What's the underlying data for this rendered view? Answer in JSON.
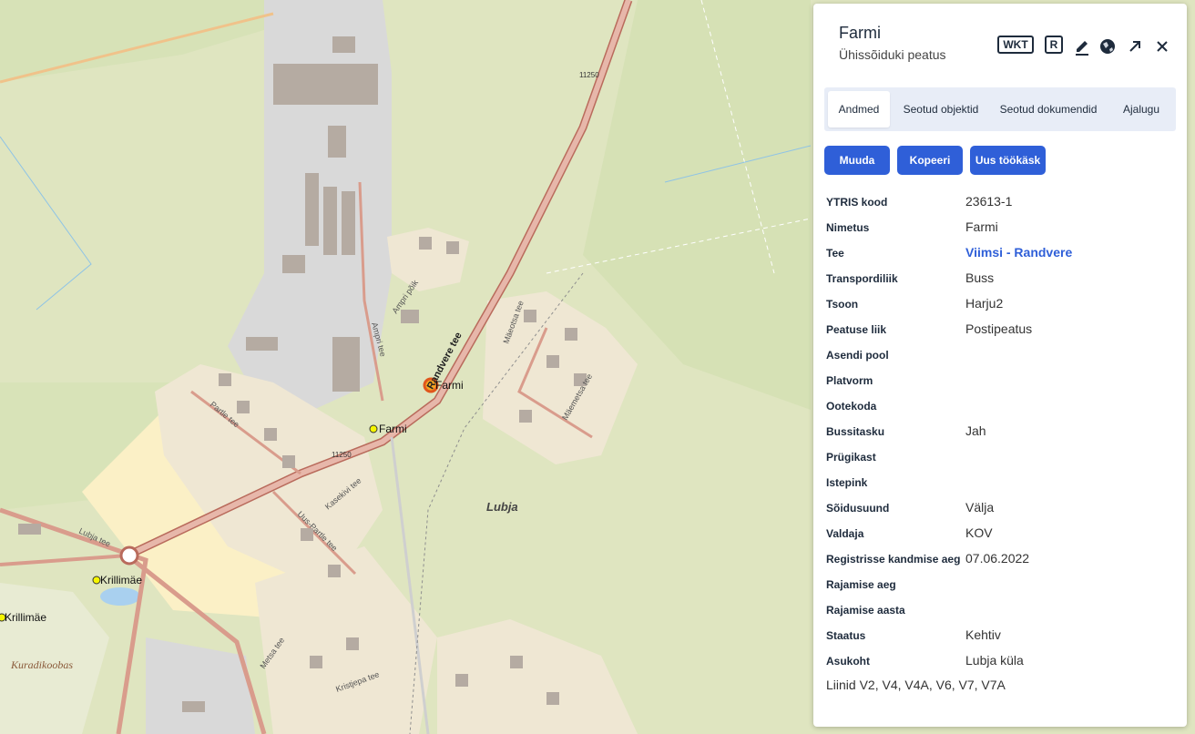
{
  "panel": {
    "title": "Farmi",
    "subtitle": "Ühissõiduki peatus",
    "toolbar": {
      "wkt_label": "WKT",
      "r_label": "R",
      "edit_icon": "pencil-icon",
      "globe_icon": "globe-icon",
      "open_icon": "arrow-up-right-icon",
      "close_icon": "close-icon"
    },
    "tabs": [
      {
        "label": "Andmed",
        "active": true
      },
      {
        "label": "Seotud objektid",
        "active": false
      },
      {
        "label": "Seotud dokumendid",
        "active": false
      },
      {
        "label": "Ajalugu",
        "active": false
      }
    ],
    "buttons": {
      "edit": "Muuda",
      "copy": "Kopeeri",
      "new_task": "Uus töökäsk"
    },
    "fields": [
      {
        "label": "YTRIS kood",
        "value": "23613-1"
      },
      {
        "label": "Nimetus",
        "value": "Farmi"
      },
      {
        "label": "Tee",
        "value": "Viimsi - Randvere",
        "link": true
      },
      {
        "label": "Transpordiliik",
        "value": "Buss"
      },
      {
        "label": "Tsoon",
        "value": "Harju2"
      },
      {
        "label": "Peatuse liik",
        "value": "Postipeatus"
      },
      {
        "label": "Asendi pool",
        "value": ""
      },
      {
        "label": "Platvorm",
        "value": ""
      },
      {
        "label": "Ootekoda",
        "value": ""
      },
      {
        "label": "Bussitasku",
        "value": "Jah"
      },
      {
        "label": "Prügikast",
        "value": ""
      },
      {
        "label": "Istepink",
        "value": ""
      },
      {
        "label": "Sõidusuund",
        "value": "Välja"
      },
      {
        "label": "Valdaja",
        "value": "KOV"
      },
      {
        "label": "Registrisse kandmise aeg",
        "value": "07.06.2022"
      },
      {
        "label": "Rajamise aeg",
        "value": ""
      },
      {
        "label": "Rajamise aasta",
        "value": ""
      },
      {
        "label": "Staatus",
        "value": "Kehtiv"
      },
      {
        "label": "Asukoht",
        "value": "Lubja küla"
      }
    ],
    "lines": "Liinid V2, V4, V4A, V6, V7, V7A"
  },
  "map": {
    "labels": {
      "randvere": "Randvere tee",
      "farmi_selected": "Farmi",
      "farmi_stop": "Farmi",
      "krillimae1": "Krillimäe",
      "krillimae2": "Krillimäe",
      "lubja": "Lubja",
      "kuradikoobas": "Kuradikoobas",
      "road_11250_a": "11250",
      "road_11250_b": "11250",
      "partle": "Partle tee",
      "ampri": "Ampri tee",
      "ampri_poik": "Ampri põik",
      "kasekivi": "Kasekivi tee",
      "uus_partle": "Uus-Partle tee",
      "lubja_tee": "Lubja tee",
      "maeotsa": "Mäeotsa tee",
      "maemetsa": "Mäemetsa tee",
      "metsa": "Metsa tee",
      "kristjepa": "Kristjepa tee"
    },
    "colors": {
      "background": "#dfe5c0",
      "field": "#d5e1b4",
      "residential": "#efe7d3",
      "industrial": "#d8d8d8",
      "sand": "#fbf0c6",
      "road_main": "#d99c8c",
      "road_edge": "#b96b5c",
      "building": "#b5aba2",
      "stop": "#f5f500",
      "selected": "#e0561c",
      "accent": "#2f5fd8"
    }
  }
}
